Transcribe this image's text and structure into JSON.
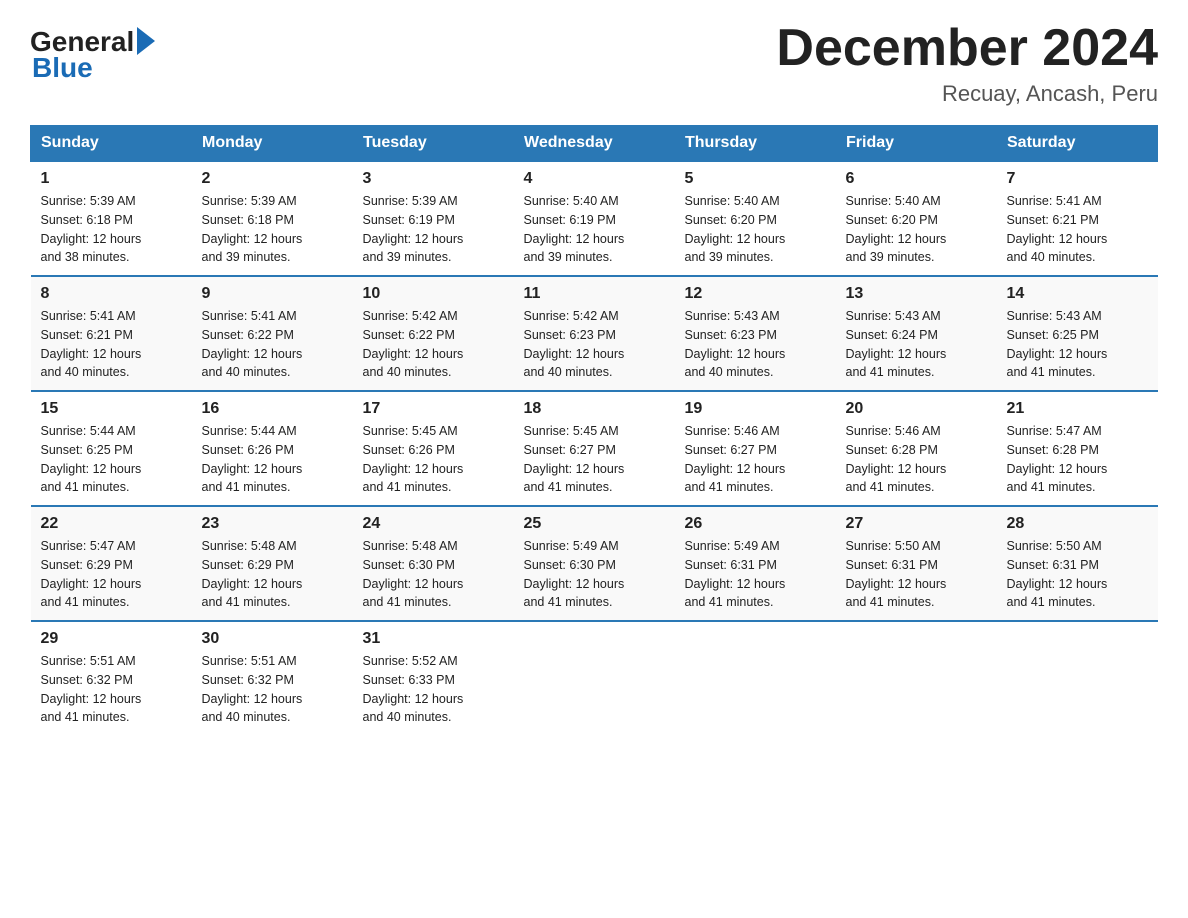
{
  "header": {
    "logo_general": "General",
    "logo_blue": "Blue",
    "title": "December 2024",
    "location": "Recuay, Ancash, Peru"
  },
  "days_of_week": [
    "Sunday",
    "Monday",
    "Tuesday",
    "Wednesday",
    "Thursday",
    "Friday",
    "Saturday"
  ],
  "weeks": [
    [
      {
        "day": "1",
        "sunrise": "5:39 AM",
        "sunset": "6:18 PM",
        "daylight": "12 hours and 38 minutes."
      },
      {
        "day": "2",
        "sunrise": "5:39 AM",
        "sunset": "6:18 PM",
        "daylight": "12 hours and 39 minutes."
      },
      {
        "day": "3",
        "sunrise": "5:39 AM",
        "sunset": "6:19 PM",
        "daylight": "12 hours and 39 minutes."
      },
      {
        "day": "4",
        "sunrise": "5:40 AM",
        "sunset": "6:19 PM",
        "daylight": "12 hours and 39 minutes."
      },
      {
        "day": "5",
        "sunrise": "5:40 AM",
        "sunset": "6:20 PM",
        "daylight": "12 hours and 39 minutes."
      },
      {
        "day": "6",
        "sunrise": "5:40 AM",
        "sunset": "6:20 PM",
        "daylight": "12 hours and 39 minutes."
      },
      {
        "day": "7",
        "sunrise": "5:41 AM",
        "sunset": "6:21 PM",
        "daylight": "12 hours and 40 minutes."
      }
    ],
    [
      {
        "day": "8",
        "sunrise": "5:41 AM",
        "sunset": "6:21 PM",
        "daylight": "12 hours and 40 minutes."
      },
      {
        "day": "9",
        "sunrise": "5:41 AM",
        "sunset": "6:22 PM",
        "daylight": "12 hours and 40 minutes."
      },
      {
        "day": "10",
        "sunrise": "5:42 AM",
        "sunset": "6:22 PM",
        "daylight": "12 hours and 40 minutes."
      },
      {
        "day": "11",
        "sunrise": "5:42 AM",
        "sunset": "6:23 PM",
        "daylight": "12 hours and 40 minutes."
      },
      {
        "day": "12",
        "sunrise": "5:43 AM",
        "sunset": "6:23 PM",
        "daylight": "12 hours and 40 minutes."
      },
      {
        "day": "13",
        "sunrise": "5:43 AM",
        "sunset": "6:24 PM",
        "daylight": "12 hours and 41 minutes."
      },
      {
        "day": "14",
        "sunrise": "5:43 AM",
        "sunset": "6:25 PM",
        "daylight": "12 hours and 41 minutes."
      }
    ],
    [
      {
        "day": "15",
        "sunrise": "5:44 AM",
        "sunset": "6:25 PM",
        "daylight": "12 hours and 41 minutes."
      },
      {
        "day": "16",
        "sunrise": "5:44 AM",
        "sunset": "6:26 PM",
        "daylight": "12 hours and 41 minutes."
      },
      {
        "day": "17",
        "sunrise": "5:45 AM",
        "sunset": "6:26 PM",
        "daylight": "12 hours and 41 minutes."
      },
      {
        "day": "18",
        "sunrise": "5:45 AM",
        "sunset": "6:27 PM",
        "daylight": "12 hours and 41 minutes."
      },
      {
        "day": "19",
        "sunrise": "5:46 AM",
        "sunset": "6:27 PM",
        "daylight": "12 hours and 41 minutes."
      },
      {
        "day": "20",
        "sunrise": "5:46 AM",
        "sunset": "6:28 PM",
        "daylight": "12 hours and 41 minutes."
      },
      {
        "day": "21",
        "sunrise": "5:47 AM",
        "sunset": "6:28 PM",
        "daylight": "12 hours and 41 minutes."
      }
    ],
    [
      {
        "day": "22",
        "sunrise": "5:47 AM",
        "sunset": "6:29 PM",
        "daylight": "12 hours and 41 minutes."
      },
      {
        "day": "23",
        "sunrise": "5:48 AM",
        "sunset": "6:29 PM",
        "daylight": "12 hours and 41 minutes."
      },
      {
        "day": "24",
        "sunrise": "5:48 AM",
        "sunset": "6:30 PM",
        "daylight": "12 hours and 41 minutes."
      },
      {
        "day": "25",
        "sunrise": "5:49 AM",
        "sunset": "6:30 PM",
        "daylight": "12 hours and 41 minutes."
      },
      {
        "day": "26",
        "sunrise": "5:49 AM",
        "sunset": "6:31 PM",
        "daylight": "12 hours and 41 minutes."
      },
      {
        "day": "27",
        "sunrise": "5:50 AM",
        "sunset": "6:31 PM",
        "daylight": "12 hours and 41 minutes."
      },
      {
        "day": "28",
        "sunrise": "5:50 AM",
        "sunset": "6:31 PM",
        "daylight": "12 hours and 41 minutes."
      }
    ],
    [
      {
        "day": "29",
        "sunrise": "5:51 AM",
        "sunset": "6:32 PM",
        "daylight": "12 hours and 41 minutes."
      },
      {
        "day": "30",
        "sunrise": "5:51 AM",
        "sunset": "6:32 PM",
        "daylight": "12 hours and 40 minutes."
      },
      {
        "day": "31",
        "sunrise": "5:52 AM",
        "sunset": "6:33 PM",
        "daylight": "12 hours and 40 minutes."
      },
      null,
      null,
      null,
      null
    ]
  ],
  "labels": {
    "sunrise": "Sunrise:",
    "sunset": "Sunset:",
    "daylight": "Daylight:"
  }
}
